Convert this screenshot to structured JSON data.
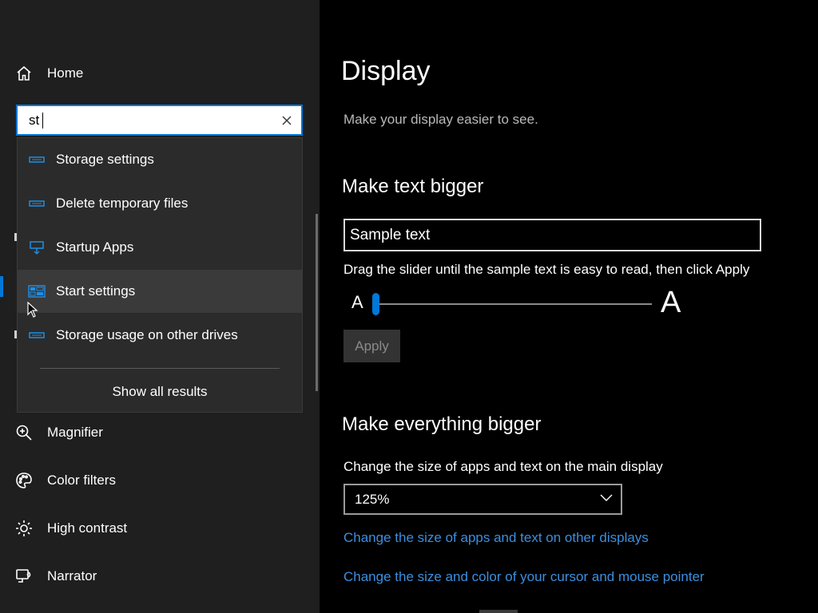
{
  "sidebar": {
    "home_label": "Home",
    "search": {
      "value": "st",
      "placeholder": ""
    },
    "suggestions": [
      {
        "label": "Storage settings",
        "icon": "storage-icon"
      },
      {
        "label": "Delete temporary files",
        "icon": "storage-icon"
      },
      {
        "label": "Startup Apps",
        "icon": "startup-icon"
      },
      {
        "label": "Start settings",
        "icon": "start-icon"
      },
      {
        "label": "Storage usage on other drives",
        "icon": "storage-icon"
      }
    ],
    "show_all_label": "Show all results",
    "items": [
      {
        "label": "Magnifier",
        "icon": "magnifier-icon"
      },
      {
        "label": "Color filters",
        "icon": "color-filters-icon"
      },
      {
        "label": "High contrast",
        "icon": "high-contrast-icon"
      },
      {
        "label": "Narrator",
        "icon": "narrator-icon"
      }
    ]
  },
  "main": {
    "title": "Display",
    "subtitle": "Make your display easier to see.",
    "text_bigger": {
      "heading": "Make text bigger",
      "sample_text": "Sample text",
      "instruction": "Drag the slider until the sample text is easy to read, then click Apply",
      "small_a": "A",
      "large_a": "A",
      "slider_percent": 0,
      "apply_label": "Apply"
    },
    "everything_bigger": {
      "heading": "Make everything bigger",
      "label": "Change the size of apps and text on the main display",
      "selected_scale": "125%",
      "link_other_displays": "Change the size of apps and text on other displays",
      "link_cursor": "Change the size and color of your cursor and mouse pointer"
    }
  },
  "colors": {
    "accent": "#0078d7",
    "link": "#3b8fe0",
    "sidebar_bg": "#1f1f1f",
    "flyout_bg": "#2b2b2b"
  }
}
